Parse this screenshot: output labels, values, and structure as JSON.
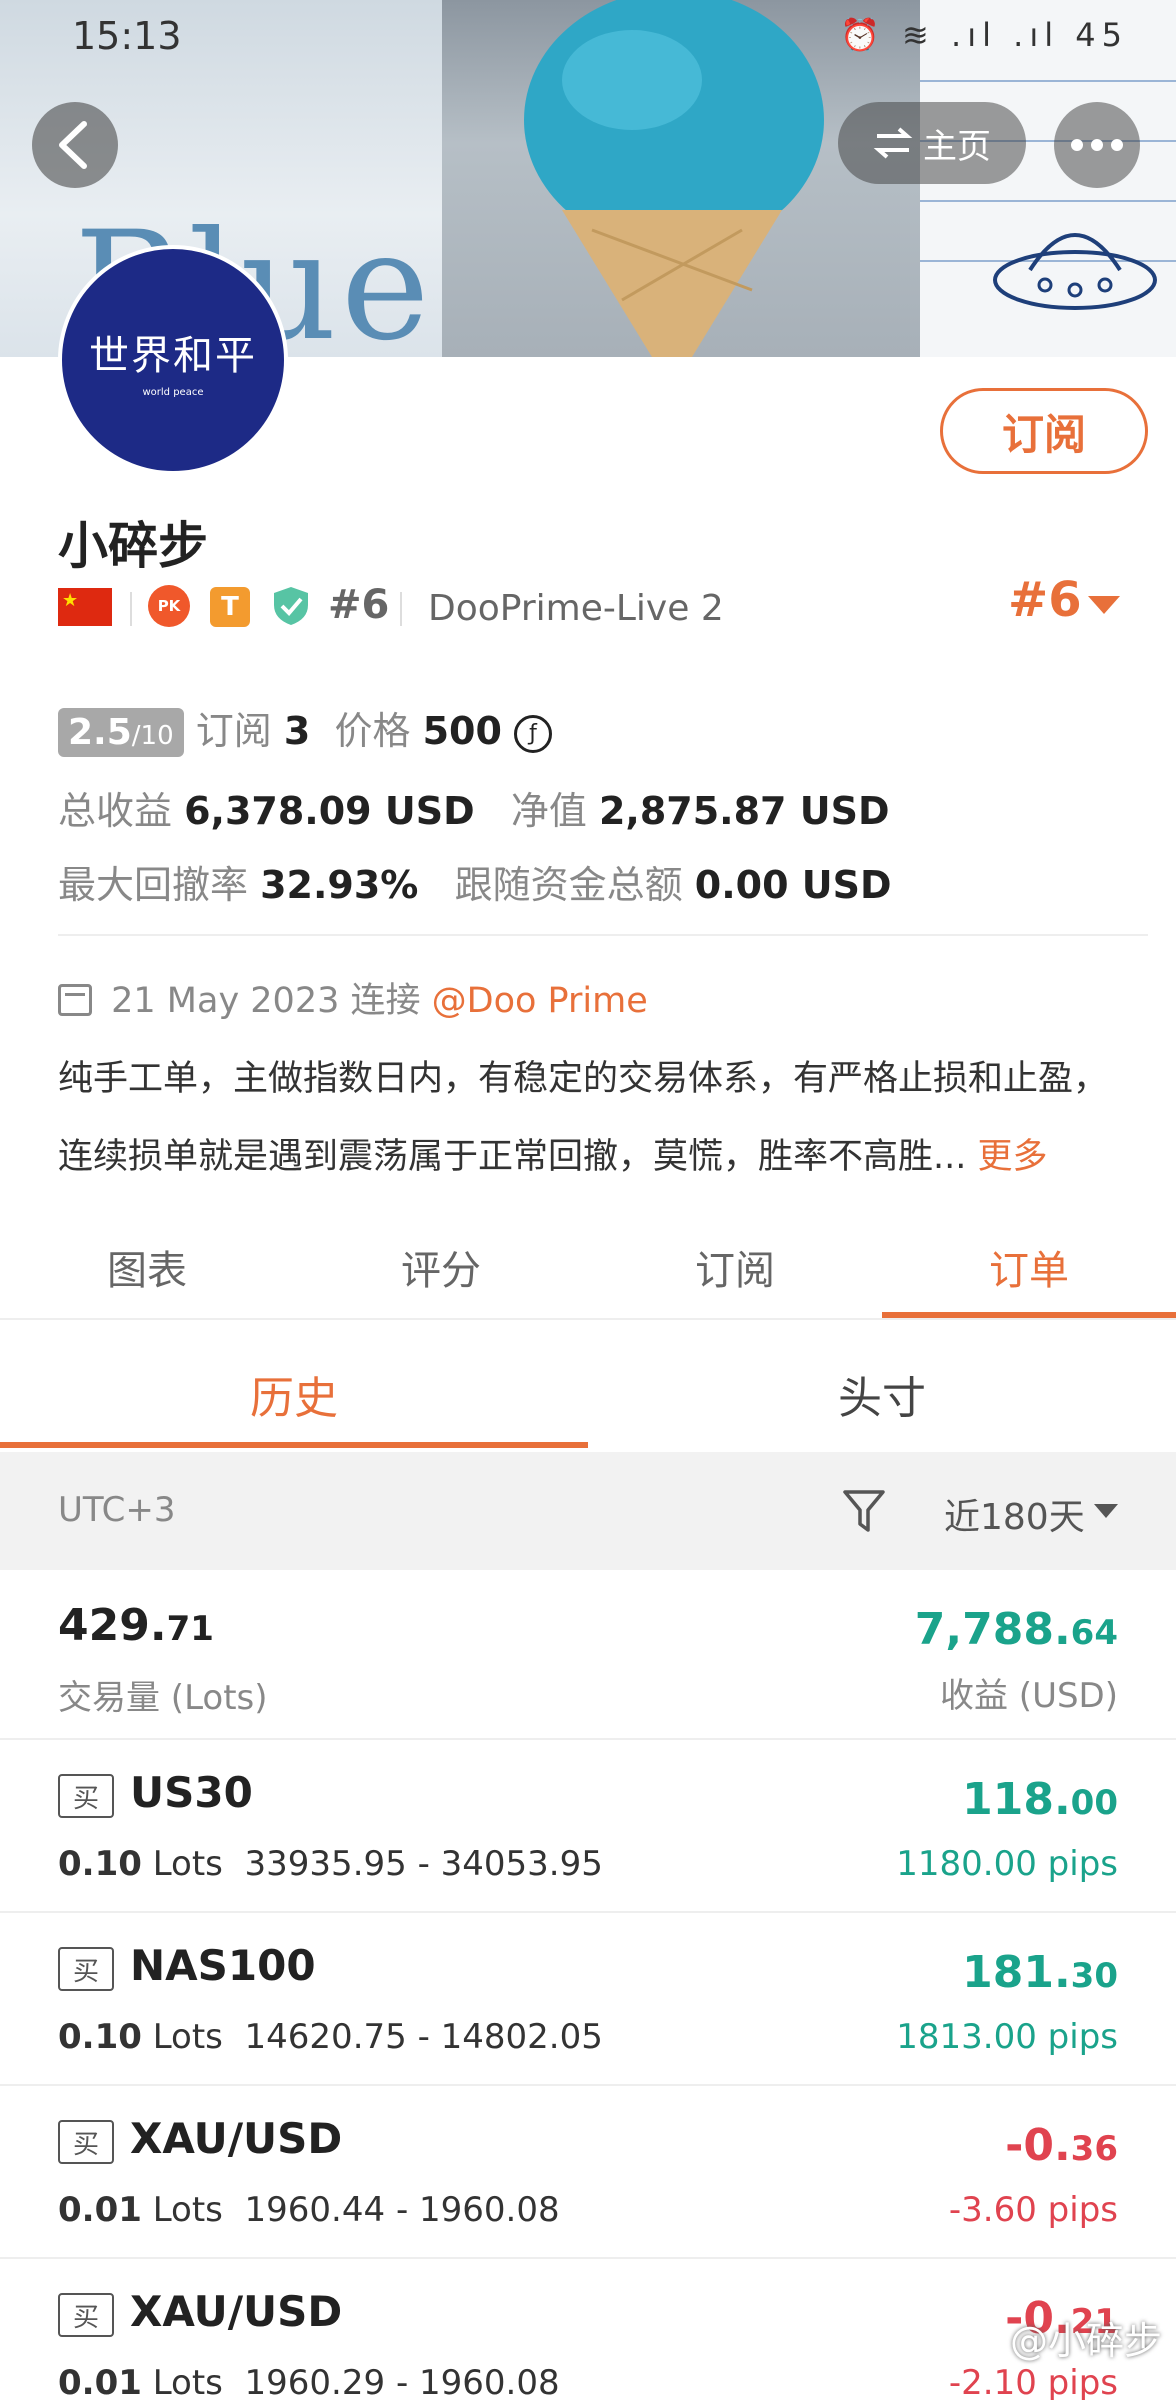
{
  "status_bar": {
    "time": "15:13",
    "icons": "⏰ ≋ .ıl .ıl 45"
  },
  "banner": {
    "panel_word": "Blue"
  },
  "header": {
    "home_label": "主页"
  },
  "profile": {
    "avatar_line1": "世界和平",
    "avatar_line2": "world peace",
    "subscribe_label": "订阅",
    "name": "小碎步",
    "badge_pk": "PK",
    "badge_t": "T",
    "rank_inline": "#6",
    "broker": "DooPrime-Live 2",
    "rank_big": "#6"
  },
  "stats": {
    "score_value": "2.5",
    "score_max": "/10",
    "subscribe_label": "订阅",
    "subscribe_count": "3",
    "price_label": "价格",
    "price_value": "500",
    "total_profit_label": "总收益",
    "total_profit_value": "6,378.09 USD",
    "net_value_label": "净值",
    "net_value_value": "2,875.87 USD",
    "max_drawdown_label": "最大回撤率",
    "max_drawdown_value": "32.93%",
    "follow_total_label": "跟随资金总额",
    "follow_total_value": "0.00 USD"
  },
  "about": {
    "joined_text": "21 May 2023 连接",
    "joined_handle": "@Doo Prime",
    "desc_line1": "纯手工单，主做指数日内，有稳定的交易体系，有严格止损和止盈，",
    "desc_line2": "连续损单就是遇到震荡属于正常回撤，莫慌，胜率不高胜...",
    "more_label": "更多"
  },
  "tabs": [
    "图表",
    "评分",
    "订阅",
    "订单"
  ],
  "subtabs": [
    "历史",
    "头寸"
  ],
  "filter": {
    "timezone": "UTC+3",
    "range": "近180天"
  },
  "summary": {
    "volume_int": "429.",
    "volume_dec": "71",
    "volume_label": "交易量 (Lots)",
    "profit_int": "7,788.",
    "profit_dec": "64",
    "profit_label": "收益 (USD)"
  },
  "orders": [
    {
      "side": "买",
      "symbol": "US30",
      "lots": "0.10",
      "lots_unit": "Lots",
      "range": "33935.95 - 34053.95",
      "pnl_int": "118.",
      "pnl_dec": "00",
      "pips": "1180.00 pips",
      "sign": "pos"
    },
    {
      "side": "买",
      "symbol": "NAS100",
      "lots": "0.10",
      "lots_unit": "Lots",
      "range": "14620.75 - 14802.05",
      "pnl_int": "181.",
      "pnl_dec": "30",
      "pips": "1813.00 pips",
      "sign": "pos"
    },
    {
      "side": "买",
      "symbol": "XAU/USD",
      "lots": "0.01",
      "lots_unit": "Lots",
      "range": "1960.44 - 1960.08",
      "pnl_int": "-0.",
      "pnl_dec": "36",
      "pips": "-3.60 pips",
      "sign": "neg"
    },
    {
      "side": "买",
      "symbol": "XAU/USD",
      "lots": "0.01",
      "lots_unit": "Lots",
      "range": "1960.29 - 1960.08",
      "pnl_int": "-0.",
      "pnl_dec": "21",
      "pips": "-2.10 pips",
      "sign": "neg"
    }
  ],
  "watermark": "@小碎步"
}
